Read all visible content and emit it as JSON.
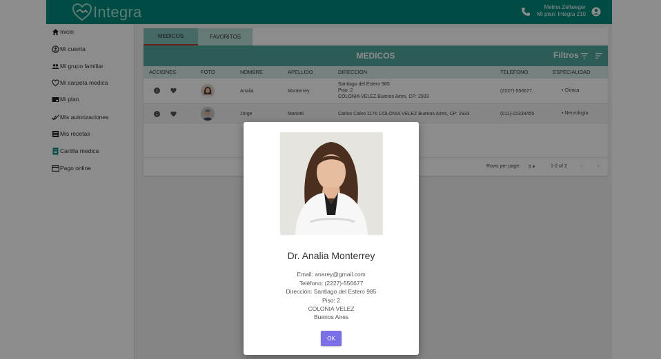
{
  "header": {
    "logo_text": "Integra",
    "user_name": "Melina Zellweger",
    "user_plan": "Mi plan: Integra 210",
    "icons": [
      "phone-icon",
      "account-icon"
    ],
    "bg_color": "#00897b"
  },
  "sidebar": {
    "items": [
      {
        "label": "Inicio",
        "icon": "home-icon"
      },
      {
        "label": "Mi cuenta",
        "icon": "account-circle-icon"
      },
      {
        "label": "Mi grupo familiar",
        "icon": "group-icon"
      },
      {
        "label": "Mi carpeta medica",
        "icon": "heart-icon"
      },
      {
        "label": "Mi plan",
        "icon": "card-icon"
      },
      {
        "label": "Mis autorizaciones",
        "icon": "check-icon"
      },
      {
        "label": "Mis recetas",
        "icon": "receipt-icon"
      },
      {
        "label": "Cartilla medica",
        "icon": "book-icon"
      },
      {
        "label": "Pago online",
        "icon": "credit-card-icon"
      }
    ]
  },
  "tabs": [
    {
      "label": "MEDICOS",
      "active": true
    },
    {
      "label": "FAVORITOS",
      "active": false
    }
  ],
  "table": {
    "title": "MEDICOS",
    "filters_label": "Filtros",
    "columns": [
      "ACCIONES",
      "FOTO",
      "NOMBRE",
      "APELLIDO",
      "DIRECCION",
      "TELEFONO",
      "ESPECIALIDAD"
    ],
    "rows": [
      {
        "nombre": "Analia",
        "apellido": "Monterrey",
        "direccion_1": "Santiago del Estero 985",
        "direccion_2": "Piso: 2",
        "direccion_3": "COLONIA VELEZ Buenos Aires, CP: 2933",
        "telefono": "(2227)-556677",
        "especialidad": "Clinica"
      },
      {
        "nombre": "Jorge",
        "apellido": "Mariotti",
        "direccion_1": "Carlos Calvo 1176 COLONIA VELEZ Buenos Aires, CP: 2933",
        "telefono": "(011)-22334455",
        "especialidad": "Neurologia"
      }
    ],
    "pagination": {
      "rows_per_page_label": "Rows per page:",
      "rows_per_page_value": "5",
      "range": "1-2 of 2"
    }
  },
  "modal": {
    "name": "Dr. Analia Monterrey",
    "email": "Email: anarey@gmail.com",
    "telefono": "Teléfono: (2227)-556677",
    "direccion": "Dirección: Santiago del Estero 985",
    "piso": "Piso: 2",
    "localidad": "COLONIA VELEZ",
    "provincia": "Buenos Aires",
    "ok_label": "OK",
    "ok_color": "#7b6fe8"
  }
}
